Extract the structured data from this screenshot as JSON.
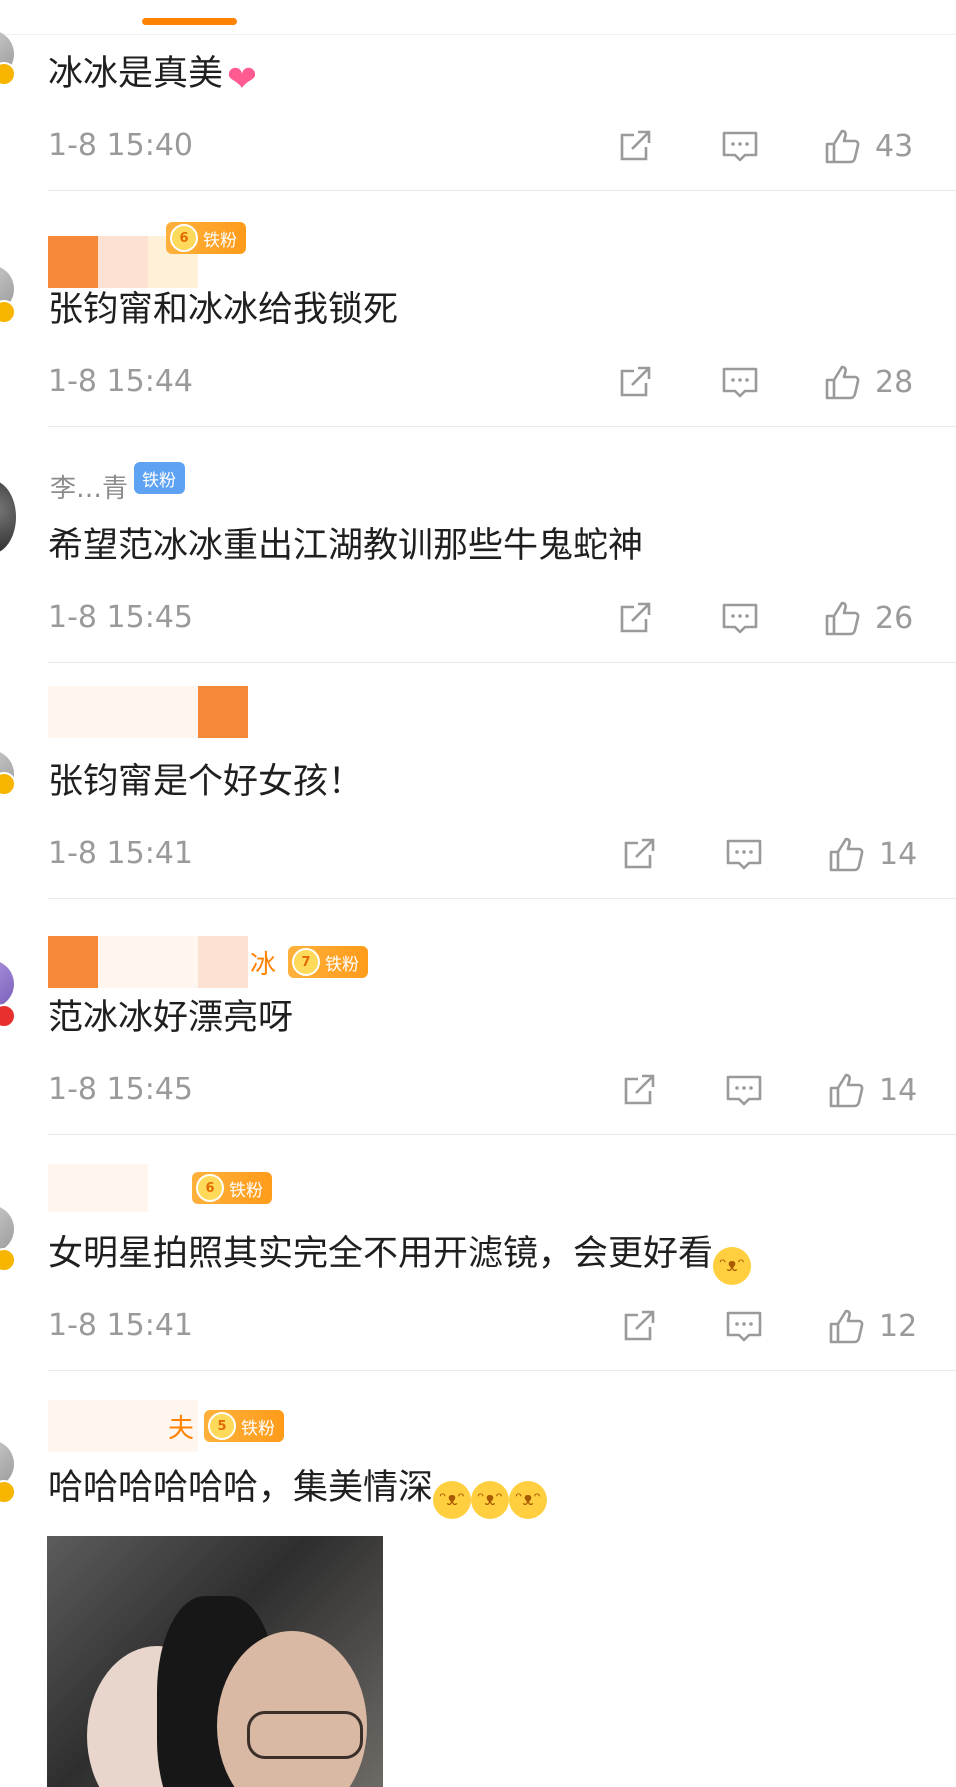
{
  "comments": [
    {
      "user": {
        "name": "",
        "fan_badge": null
      },
      "text": "冰冰是真美",
      "emoji": "heart",
      "time": "1-8 15:40",
      "likes": "43"
    },
    {
      "user": {
        "name": "",
        "fan_badge": {
          "level": "6",
          "label": "铁粉"
        }
      },
      "text": "张钧甯和冰冰给我锁死",
      "time": "1-8 15:44",
      "likes": "28"
    },
    {
      "user": {
        "name": "李…青",
        "fan_badge": {
          "level": "",
          "label": "铁粉"
        }
      },
      "text": "希望范冰冰重出江湖教训那些牛鬼蛇神",
      "time": "1-8 15:45",
      "likes": "26"
    },
    {
      "user": {
        "name": "",
        "fan_badge": null
      },
      "text": "张钧甯是个好女孩！",
      "time": "1-8 15:41",
      "likes": "14"
    },
    {
      "user": {
        "name": "冰",
        "fan_badge": {
          "level": "7",
          "label": "铁粉"
        }
      },
      "text": "范冰冰好漂亮呀",
      "time": "1-8 15:45",
      "likes": "14"
    },
    {
      "user": {
        "name": "",
        "fan_badge": {
          "level": "6",
          "label": "铁粉"
        }
      },
      "text": "女明星拍照其实完全不用开滤镜，会更好看",
      "emoji": "laugh",
      "time": "1-8 15:41",
      "likes": "12"
    },
    {
      "user": {
        "name": "夫",
        "fan_badge": {
          "level": "5",
          "label": "铁粉"
        }
      },
      "text": "哈哈哈哈哈哈，集美情深",
      "emoji_count": 3,
      "emoji": "laugh-cry"
    }
  ],
  "icons": {
    "repost": "repost-icon",
    "comment": "comment-icon",
    "like": "like-icon"
  },
  "colors": {
    "accent": "#ff8200",
    "username": "#ff8200",
    "meta": "#9a9a9a",
    "fan_badge": "#ffa726",
    "fan_badge_blue": "#5ea2f3"
  }
}
